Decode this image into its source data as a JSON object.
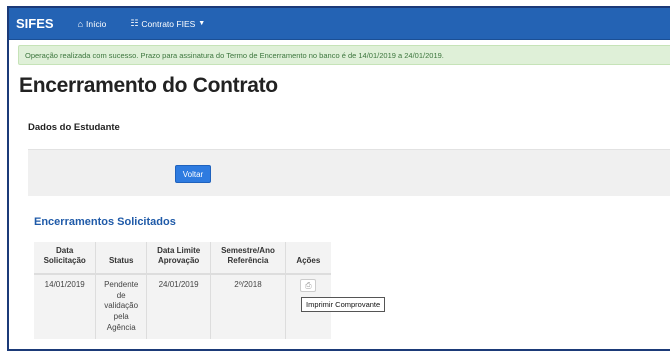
{
  "navbar": {
    "brand": "SIFES",
    "items": [
      {
        "label": "Início",
        "icon": "home-icon"
      },
      {
        "label": "Contrato FIES",
        "icon": "list-icon",
        "has_dropdown": true
      }
    ]
  },
  "alert": {
    "message": "Operação realizada com sucesso. Prazo para assinatura do Termo de Encerramento no banco é de 14/01/2019 a 24/01/2019."
  },
  "page": {
    "title": "Encerramento do Contrato",
    "section_label": "Dados do Estudante",
    "back_button": "Voltar"
  },
  "requests": {
    "title": "Encerramentos Solicitados",
    "columns": [
      "Data Solicitação",
      "Status",
      "Data Limite Aprovação",
      "Semestre/Ano Referência",
      "Ações"
    ],
    "rows": [
      {
        "data_solicitacao": "14/01/2019",
        "status": "Pendente de validação pela Agência",
        "data_limite": "24/01/2019",
        "semestre_ano": "2º/2018"
      }
    ],
    "print_tooltip": "Imprimir Comprovante"
  },
  "colors": {
    "navbar": "#2463b4",
    "alert_bg": "#dff0d8",
    "alert_text": "#3c763d",
    "link_title": "#1f5aa8",
    "primary_button": "#2e7be0"
  }
}
